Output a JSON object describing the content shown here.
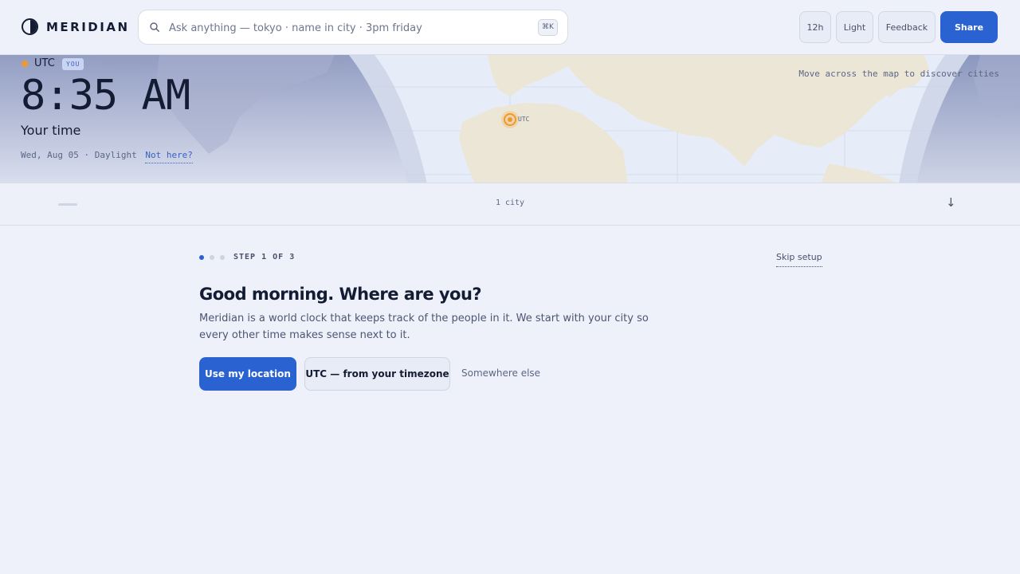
{
  "app": {
    "name": "MERIDIAN"
  },
  "search": {
    "placeholder": "Ask anything — tokyo · name in city · 3pm friday",
    "shortcut": "⌘K"
  },
  "header": {
    "format_button": "12h",
    "theme_button": "Light",
    "feedback_button": "Feedback",
    "share_button": "Share"
  },
  "map": {
    "hint": "Move across the map to discover cities",
    "marker_label": "UTC"
  },
  "clock": {
    "tz_name": "UTC",
    "badge": "YOU",
    "time": "8:35 AM",
    "label": "Your time",
    "meta": "Wed, Aug 05 · Daylight",
    "not_here": "Not here?"
  },
  "cities": {
    "count": "1 city",
    "collapse_icon": "arrow-down-icon"
  },
  "onboarding": {
    "step": "STEP 1 OF 3",
    "step_total": 3,
    "step_current": 1,
    "skip": "Skip setup",
    "title": "Good morning. Where are you?",
    "description": "Meridian is a world clock that keeps track of the people in it. We start with your city so every other time makes sense next to it.",
    "primary": "Use my location",
    "secondary": "UTC — from your timezone",
    "tertiary": "Somewhere else"
  },
  "colors": {
    "accent": "#2a62d1",
    "background": "#eef1f9",
    "marker": "#ee9a2c",
    "night": "#8d98bf"
  }
}
